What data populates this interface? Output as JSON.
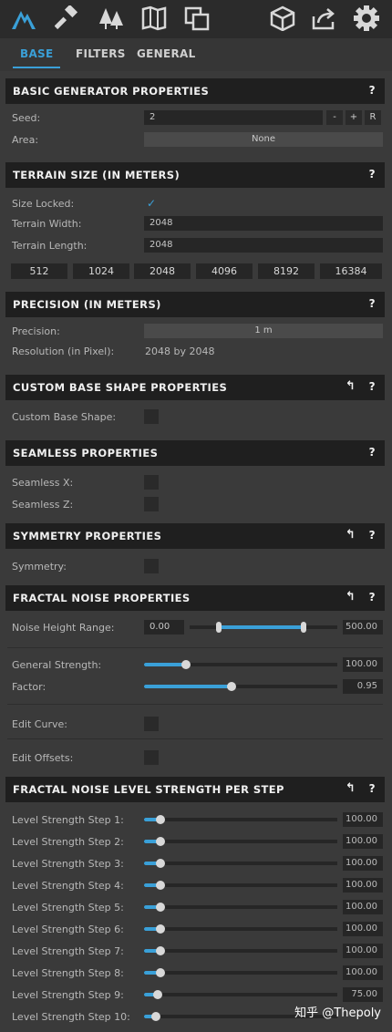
{
  "toolbar": {
    "icons": [
      "mountain-icon",
      "hammer-icon",
      "trees-icon",
      "map-icon",
      "layers-icon",
      "cube-icon",
      "share-icon",
      "gear-icon"
    ]
  },
  "tabs": [
    "BASE",
    "FILTERS",
    "GENERAL"
  ],
  "colors": {
    "accent": "#3aa0d8",
    "header_bg": "#1f1f1f",
    "panel_bg": "#3a3a3a"
  },
  "basic": {
    "title": "BASIC GENERATOR PROPERTIES",
    "help": "?",
    "seed_label": "Seed:",
    "seed_value": "2",
    "minus": "-",
    "plus": "+",
    "random": "R",
    "area_label": "Area:",
    "area_value": "None"
  },
  "terrain": {
    "title": "TERRAIN SIZE (IN METERS)",
    "help": "?",
    "size_locked_label": "Size Locked:",
    "size_locked_check": "✓",
    "width_label": "Terrain Width:",
    "width_value": "2048",
    "length_label": "Terrain Length:",
    "length_value": "2048",
    "sizes": [
      "512",
      "1024",
      "2048",
      "4096",
      "8192",
      "16384"
    ]
  },
  "precision": {
    "title": "PRECISION (IN METERS)",
    "help": "?",
    "precision_label": "Precision:",
    "precision_value": "1 m",
    "resolution_label": "Resolution (in Pixel):",
    "resolution_value": "2048 by 2048"
  },
  "custom_shape": {
    "title": "CUSTOM BASE SHAPE PROPERTIES",
    "back": "↰",
    "help": "?",
    "label": "Custom Base Shape:"
  },
  "seamless": {
    "title": "SEAMLESS PROPERTIES",
    "help": "?",
    "x_label": "Seamless X:",
    "z_label": "Seamless Z:"
  },
  "symmetry": {
    "title": "SYMMETRY PROPERTIES",
    "back": "↰",
    "help": "?",
    "label": "Symmetry:"
  },
  "fractal": {
    "title": "FRACTAL NOISE PROPERTIES",
    "back": "↰",
    "help": "?",
    "noise_label": "Noise Height Range:",
    "noise_min": "0.00",
    "noise_max": "500.00",
    "strength_label": "General Strength:",
    "strength_value": "100.00",
    "factor_label": "Factor:",
    "factor_value": "0.95",
    "edit_curve_label": "Edit Curve:",
    "edit_offsets_label": "Edit Offsets:"
  },
  "levels": {
    "title": "FRACTAL NOISE LEVEL STRENGTH PER STEP",
    "back": "↰",
    "help": "?",
    "steps": [
      {
        "label": "Level Strength Step 1:",
        "value": "100.00"
      },
      {
        "label": "Level Strength Step 2:",
        "value": "100.00"
      },
      {
        "label": "Level Strength Step 3:",
        "value": "100.00"
      },
      {
        "label": "Level Strength Step 4:",
        "value": "100.00"
      },
      {
        "label": "Level Strength Step 5:",
        "value": "100.00"
      },
      {
        "label": "Level Strength Step 6:",
        "value": "100.00"
      },
      {
        "label": "Level Strength Step 7:",
        "value": "100.00"
      },
      {
        "label": "Level Strength Step 8:",
        "value": "100.00"
      },
      {
        "label": "Level Strength Step 9:",
        "value": "75.00"
      },
      {
        "label": "Level Strength Step 10:",
        "value": ""
      }
    ]
  },
  "watermark": "知乎 @Thepoly"
}
